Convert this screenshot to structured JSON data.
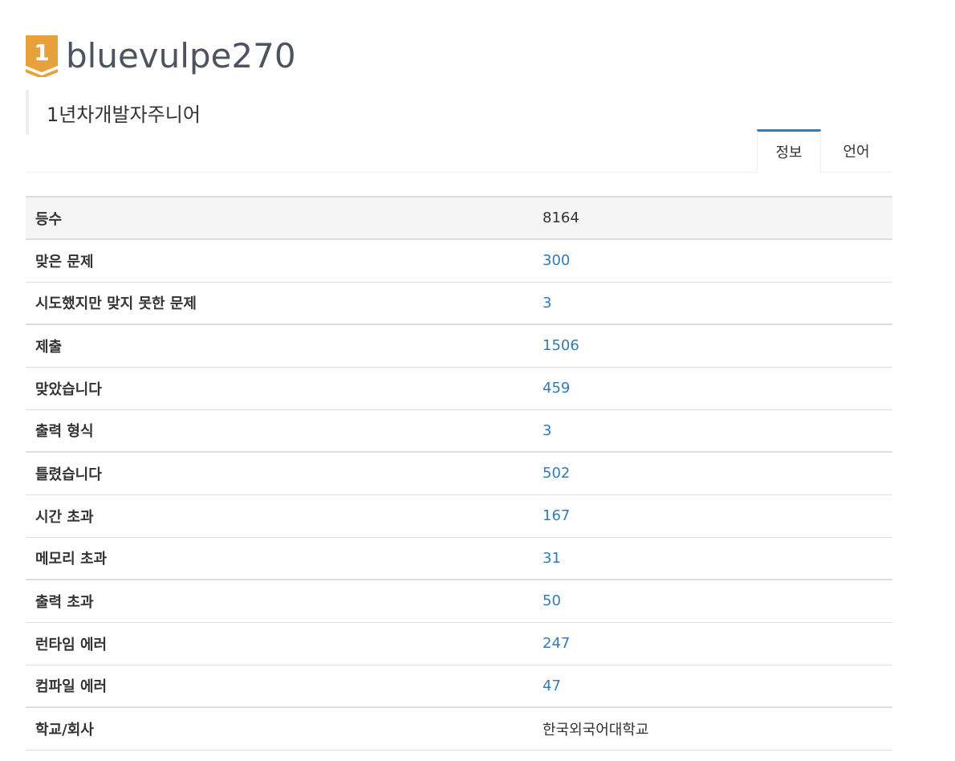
{
  "profile": {
    "tier_number": "1",
    "username": "bluevulpe270",
    "status_message": "1년차개발자주니어"
  },
  "tabs": [
    {
      "label": "정보",
      "active": true
    },
    {
      "label": "언어",
      "active": false
    }
  ],
  "colors": {
    "badge": "#e7a13b",
    "link": "#337ab7",
    "active_tab_border": "#337ab7"
  },
  "stats": {
    "rank": {
      "label": "등수",
      "value": "8164"
    },
    "solved": {
      "label": "맞은 문제",
      "value": "300"
    },
    "attempted": {
      "label": "시도했지만 맞지 못한 문제",
      "value": "3"
    },
    "submissions": {
      "label": "제출",
      "value": "1506"
    },
    "accepted": {
      "label": "맞았습니다",
      "value": "459"
    },
    "presentation_error": {
      "label": "출력 형식",
      "value": "3"
    },
    "wrong_answer": {
      "label": "틀렸습니다",
      "value": "502"
    },
    "time_limit": {
      "label": "시간 초과",
      "value": "167"
    },
    "memory_limit": {
      "label": "메모리 초과",
      "value": "31"
    },
    "output_limit": {
      "label": "출력 초과",
      "value": "50"
    },
    "runtime_error": {
      "label": "런타임 에러",
      "value": "247"
    },
    "compile_error": {
      "label": "컴파일 에러",
      "value": "47"
    },
    "school": {
      "label": "학교/회사",
      "value": "한국외국어대학교"
    }
  }
}
